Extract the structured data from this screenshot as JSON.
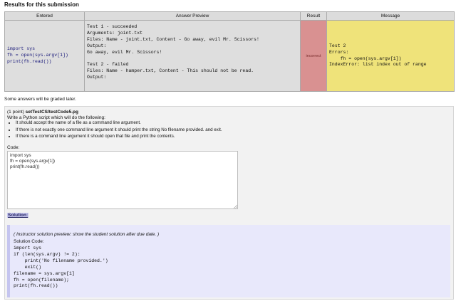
{
  "results": {
    "heading": "Results for this submission",
    "columns": [
      "Entered",
      "Answer Preview",
      "Result",
      "Message"
    ],
    "entered_code": "import sys\nfh = open(sys.argv[1])\nprint(fh.read())",
    "answer_preview": "Test 1 - succeeded\nArguments: joint.txt\nFiles: Name - joint.txt, Content - Go away, evil Mr. Scissors!\nOutput:\nGo away, evil Mr. Scissors!\n\nTest 2 - failed\nFiles: Name - hamper.txt, Content - This should not be read.\nOutput:",
    "result": "incorrect",
    "message": "Test 2\nErrors:\n    fh = open(sys.argv[1])\nIndexError: list index out of range"
  },
  "graded_note": "Some answers will be graded later.",
  "problem": {
    "points": "(1 point)",
    "file": "setTestCS/testCode5.pg",
    "intro": "Write a Python script which will do the following:",
    "requirements": [
      "It should accept the name of a file as a command line argument.",
      "If there is not exactly one command line argument it should print the string No filename provided. and exit.",
      "If there is a command line argument it should open that file and print the contents."
    ],
    "code_label": "Code:",
    "code_value": "import sys\nfh = open(sys.argv[1])\nprint(fh.read())"
  },
  "solution": {
    "toggle_label": "Solution:",
    "instructor_note": "( Instructor solution preview: show the student solution after due date. )",
    "code_label": "Solution Code:",
    "code": "import sys\nif (len(sys.argv) != 2):\n    print('No filename provided.')\n    exit()\nfilename = sys.argv[1]\nfh = open(filename);\nprint(fh.read())"
  },
  "colors": {
    "incorrect": "#d99191",
    "message": "#efe37a",
    "solution_bg": "#e8e8fb"
  }
}
